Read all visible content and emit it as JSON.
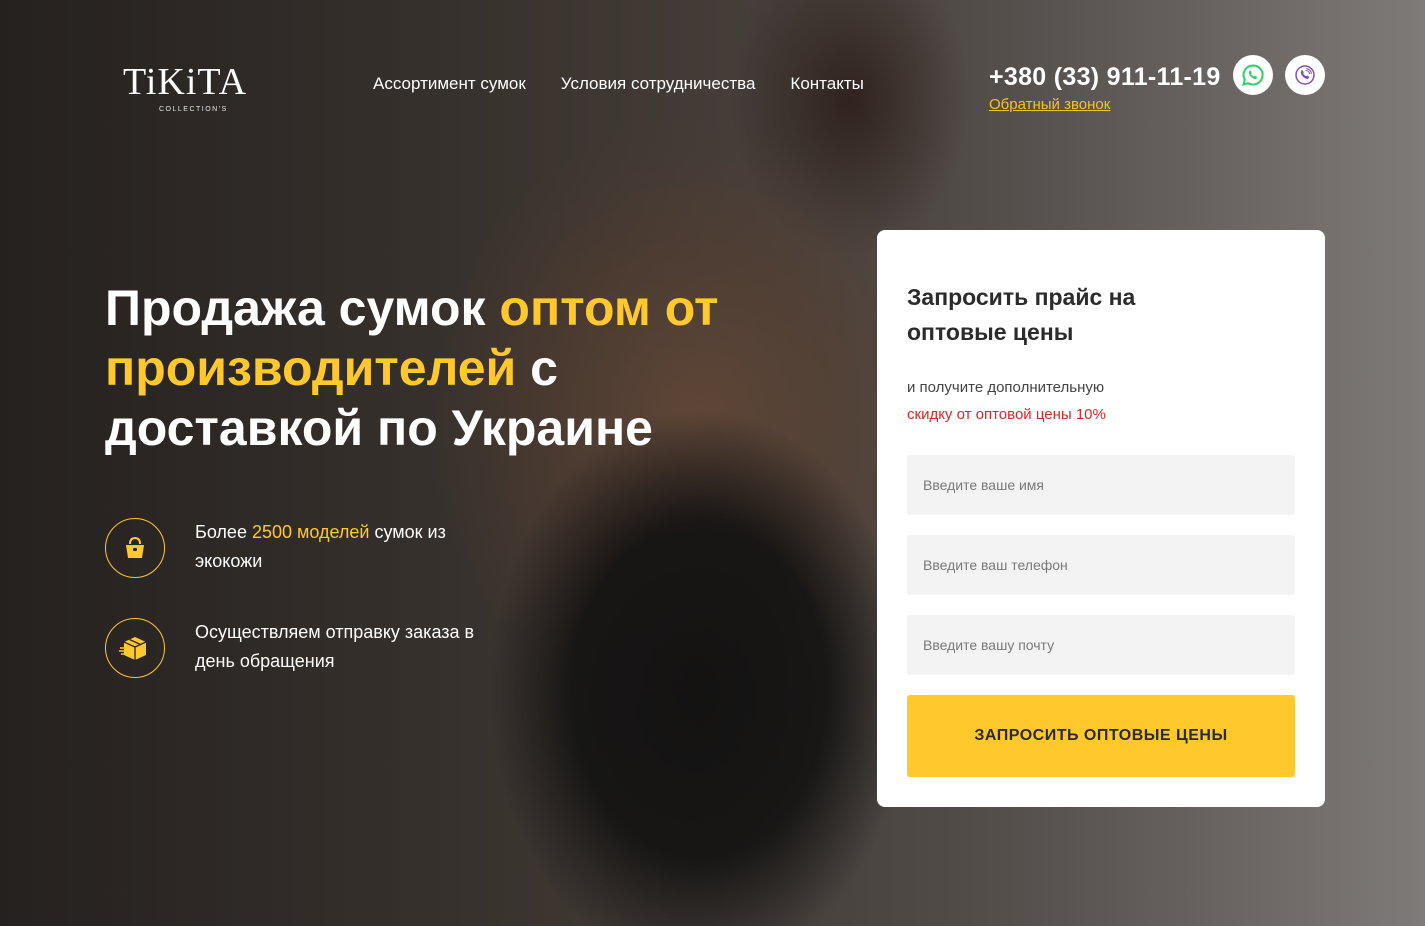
{
  "brand": {
    "logo_main": "TiKiTA",
    "logo_sub": "COLLECTION'S"
  },
  "nav": {
    "items": [
      {
        "label": "Ассортимент сумок"
      },
      {
        "label": "Условия сотрудничества"
      },
      {
        "label": "Контакты"
      }
    ]
  },
  "contact": {
    "phone": "+380 (33) 911-11-19",
    "callback_label": "Обратный звонок",
    "icons": [
      "whatsapp-icon",
      "viber-icon"
    ]
  },
  "hero": {
    "headline_part1": "Продажа сумок ",
    "headline_accent": "оптом от производителей",
    "headline_part2": " с доставкой по Украине"
  },
  "features": [
    {
      "icon": "handbag-icon",
      "text_before": "Более ",
      "text_accent": "2500 моделей",
      "text_after": " сумок из экокожи"
    },
    {
      "icon": "delivery-box-icon",
      "text_before": "Осуществляем отправку заказа в день обращения",
      "text_accent": "",
      "text_after": ""
    }
  ],
  "form": {
    "title": "Запросить прайс на оптовые цены",
    "subtitle": "и получите дополнительную",
    "promo": "скидку от оптовой цены 10%",
    "name_placeholder": "Введите ваше имя",
    "phone_placeholder": "Введите ваш телефон",
    "email_placeholder": "Введите вашу почту",
    "submit_label": "ЗАПРОСИТЬ ОПТОВЫЕ ЦЕНЫ"
  },
  "colors": {
    "accent": "#ffc82c",
    "promo": "#e02424",
    "link": "#f5c518",
    "whatsapp": "#25d366",
    "viber": "#7d52b7"
  }
}
